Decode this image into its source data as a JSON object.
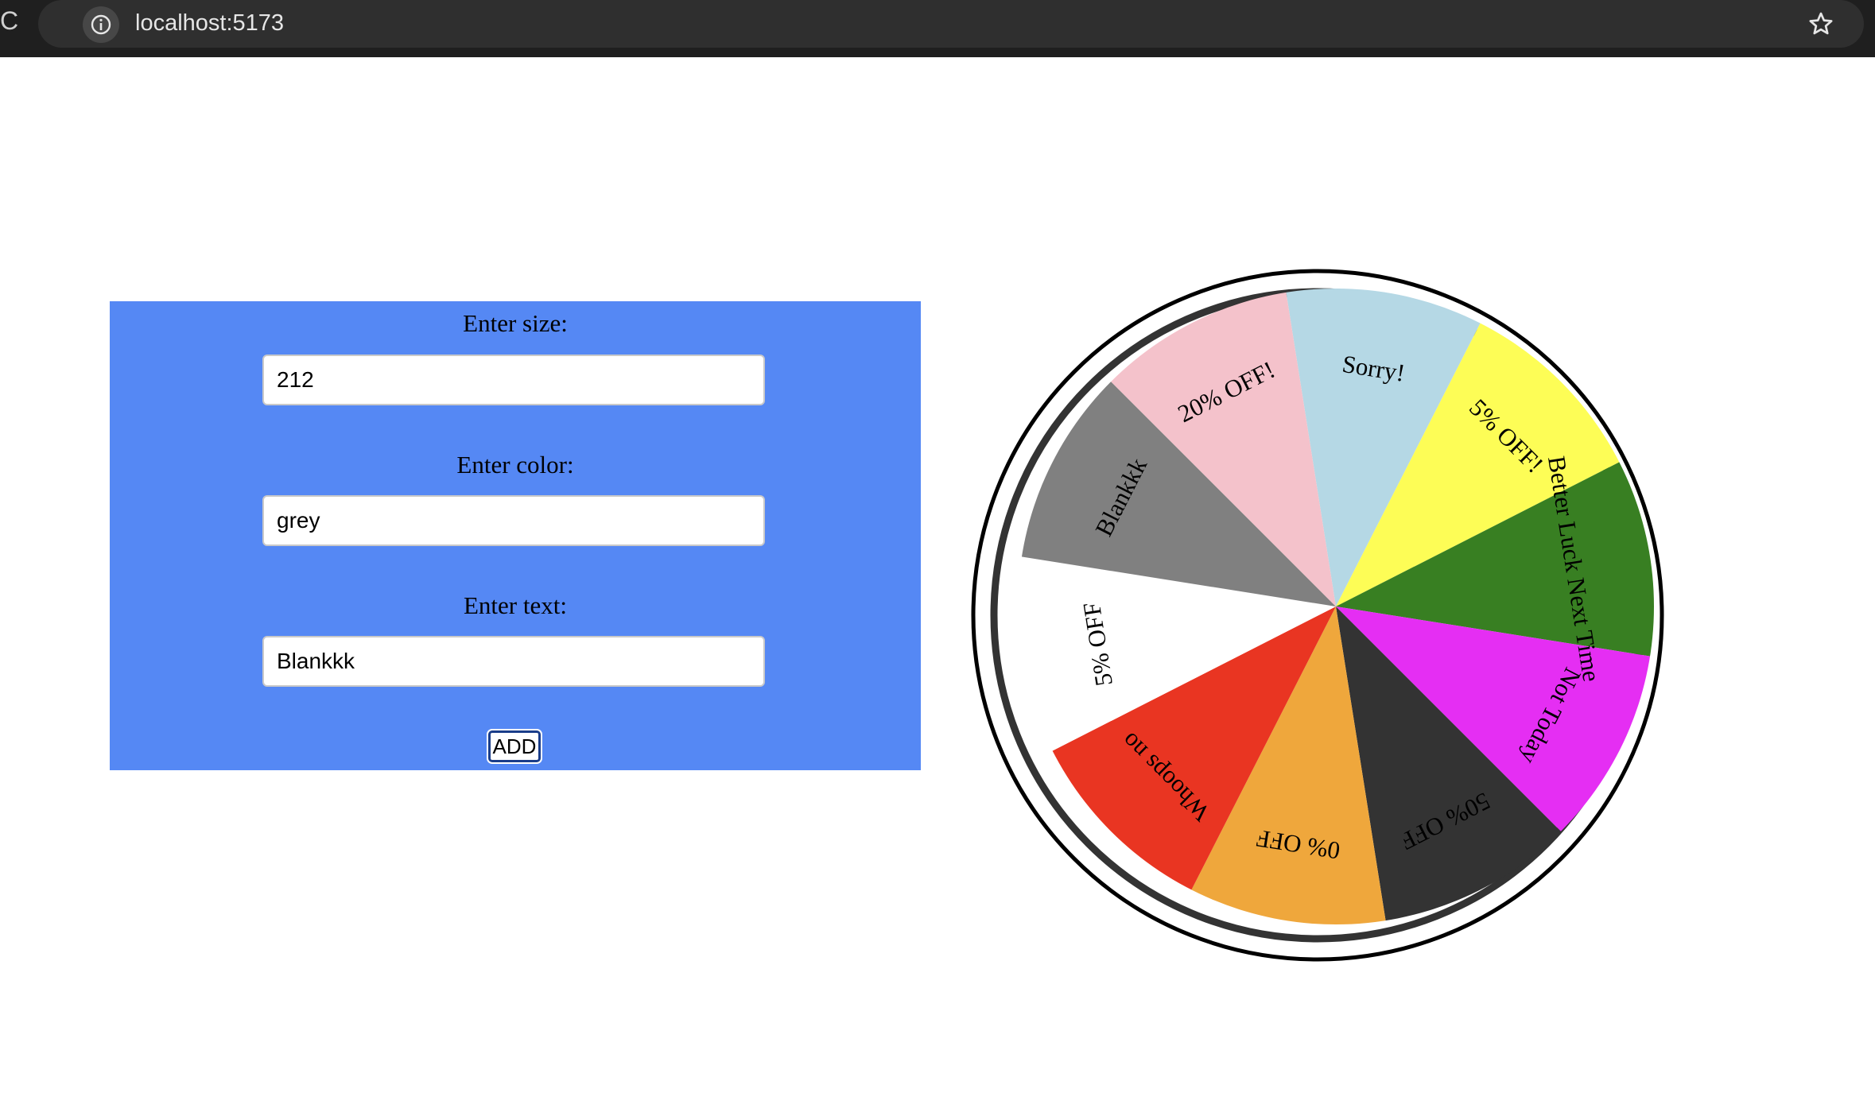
{
  "browser": {
    "url": "localhost:5173",
    "left_glyph": "C"
  },
  "form": {
    "size_label": "Enter size:",
    "size_value": "212",
    "color_label": "Enter color:",
    "color_value": "grey",
    "text_label": "Enter text:",
    "text_value": "Blankkk",
    "add_button": "ADD"
  },
  "wheel": {
    "ring_color": "#000000",
    "track_color": "#333333",
    "segments": [
      {
        "text": "Sorry!",
        "color": "#b5d8e5"
      },
      {
        "text": "5% OFF!",
        "color": "#fdfd56"
      },
      {
        "text": "Better Luck Next Time",
        "color": "#387f22"
      },
      {
        "text": "Not Today",
        "color": "#e52ef3"
      },
      {
        "text": "50% OFF",
        "color": "#333333"
      },
      {
        "text": "0% OFF",
        "color": "#efa73c"
      },
      {
        "text": "Whoops no",
        "color": "#e93522"
      },
      {
        "text": "5% OFF",
        "color": "#ffffff"
      },
      {
        "text": "Blankkk",
        "color": "#808080"
      },
      {
        "text": "20% OFF!",
        "color": "#f4c2cb"
      }
    ]
  }
}
